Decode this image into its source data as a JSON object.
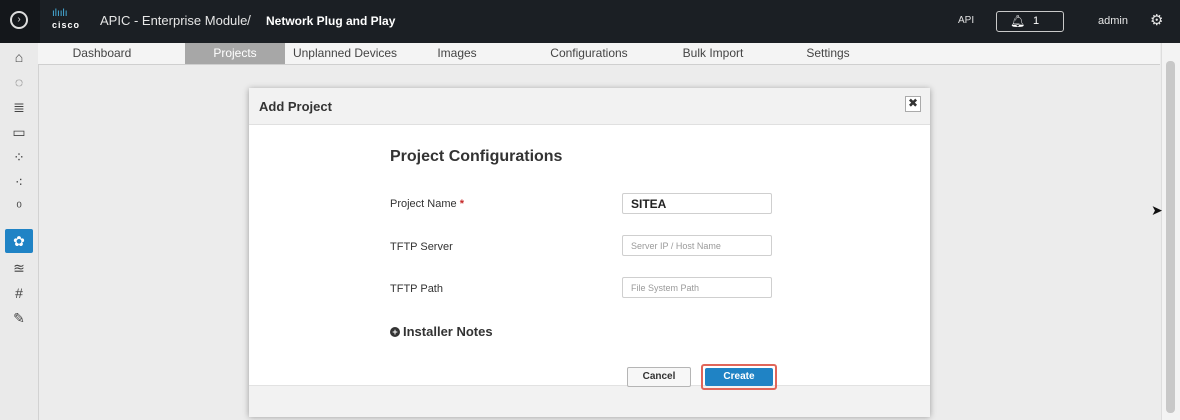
{
  "header": {
    "logo_bars": "ılıılı",
    "logo_text": "cisco",
    "app_title": "APIC - Enterprise Module",
    "separator": "/",
    "page_name": "Network Plug and Play",
    "api_label": "API",
    "notifications_count": "1",
    "user": "admin"
  },
  "tabs": [
    "Dashboard",
    "Projects",
    "Unplanned Devices",
    "Images",
    "Configurations",
    "Bulk Import",
    "Settings"
  ],
  "active_tab": "Projects",
  "modal": {
    "title": "Add Project",
    "close_symbol": "✖",
    "section_title": "Project Configurations",
    "fields": {
      "project_name": {
        "label": "Project Name",
        "required_mark": "*",
        "value": "SITEA"
      },
      "tftp_server": {
        "label": "TFTP Server",
        "placeholder": "Server IP / Host Name"
      },
      "tftp_path": {
        "label": "TFTP Path",
        "placeholder": "File System Path"
      }
    },
    "installer_notes": "Installer Notes",
    "cancel_label": "Cancel",
    "create_label": "Create"
  },
  "colors": {
    "accent": "#1f83c5",
    "topbar": "#1b1f24",
    "highlight_border": "#e0665a"
  }
}
